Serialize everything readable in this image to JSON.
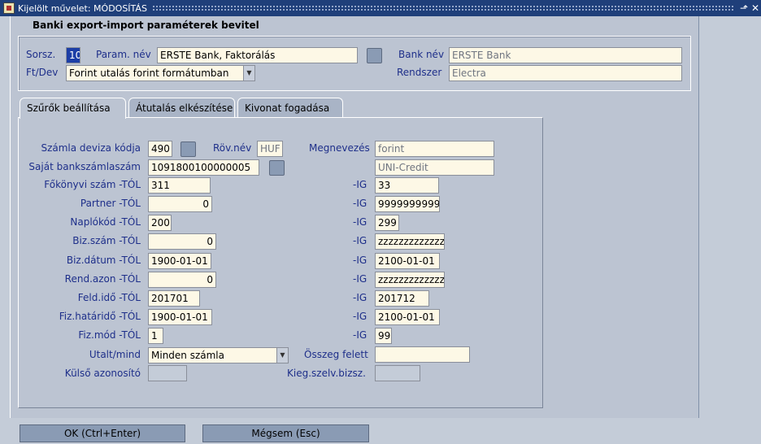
{
  "window": {
    "title": "Kijelölt művelet: MÓDOSÍTÁS",
    "minimize_glyph": "⬏",
    "close_glyph": "✕"
  },
  "form": {
    "title": "Banki export-import paraméterek bevitel"
  },
  "header": {
    "sorsz_label": "Sorsz.",
    "sorsz_value": "10",
    "param_label": "Param. név",
    "param_value": "ERSTE Bank, Faktorálás",
    "bank_label": "Bank név",
    "bank_value": "ERSTE Bank",
    "ftdev_label": "Ft/Dev",
    "ftdev_value": "Forint utalás forint formátumban",
    "rendszer_label": "Rendszer",
    "rendszer_value": "Electra"
  },
  "tabs": [
    {
      "label": "Szűrők beállítása",
      "active": true
    },
    {
      "label": "Átutalás elkészítése",
      "active": false
    },
    {
      "label": "Kivonat fogadása",
      "active": false
    }
  ],
  "filters": {
    "deviza_label": "Számla deviza kódja",
    "deviza_value": "490",
    "rov_label": "Röv.név",
    "rov_value": "HUF",
    "megn_label": "Megnevezés",
    "megn_value": "forint",
    "bankszamla_label": "Saját bankszámlaszám",
    "bankszamla_value": "1091800100000005",
    "bankszamla_desc": "UNI-Credit",
    "ig_label": "-IG",
    "rows": [
      {
        "label": "Főkönyvi szám -TÓL",
        "from": "311",
        "to": "33"
      },
      {
        "label": "Partner -TÓL",
        "from": "0",
        "to": "9999999999"
      },
      {
        "label": "Naplókód -TÓL",
        "from": "200",
        "to": "299"
      },
      {
        "label": "Biz.szám -TÓL",
        "from": "0",
        "to": "zzzzzzzzzzzzz"
      },
      {
        "label": "Biz.dátum -TÓL",
        "from": "1900-01-01",
        "to": "2100-01-01"
      },
      {
        "label": "Rend.azon -TÓL",
        "from": "0",
        "to": "zzzzzzzzzzzzz"
      },
      {
        "label": "Feld.idő -TÓL",
        "from": "201701",
        "to": "201712"
      },
      {
        "label": "Fiz.határidő -TÓL",
        "from": "1900-01-01",
        "to": "2100-01-01"
      },
      {
        "label": "Fiz.mód -TÓL",
        "from": "1",
        "to": "99"
      }
    ],
    "utalt_label": "Utalt/mind",
    "utalt_value": "Minden számla",
    "osszeg_label": "Összeg felett",
    "osszeg_value": "",
    "kulso_label": "Külső azonosító",
    "kieg_label": "Kieg.szelv.bizsz."
  },
  "buttons": {
    "ok": "OK (Ctrl+Enter)",
    "cancel": "Mégsem (Esc)"
  }
}
